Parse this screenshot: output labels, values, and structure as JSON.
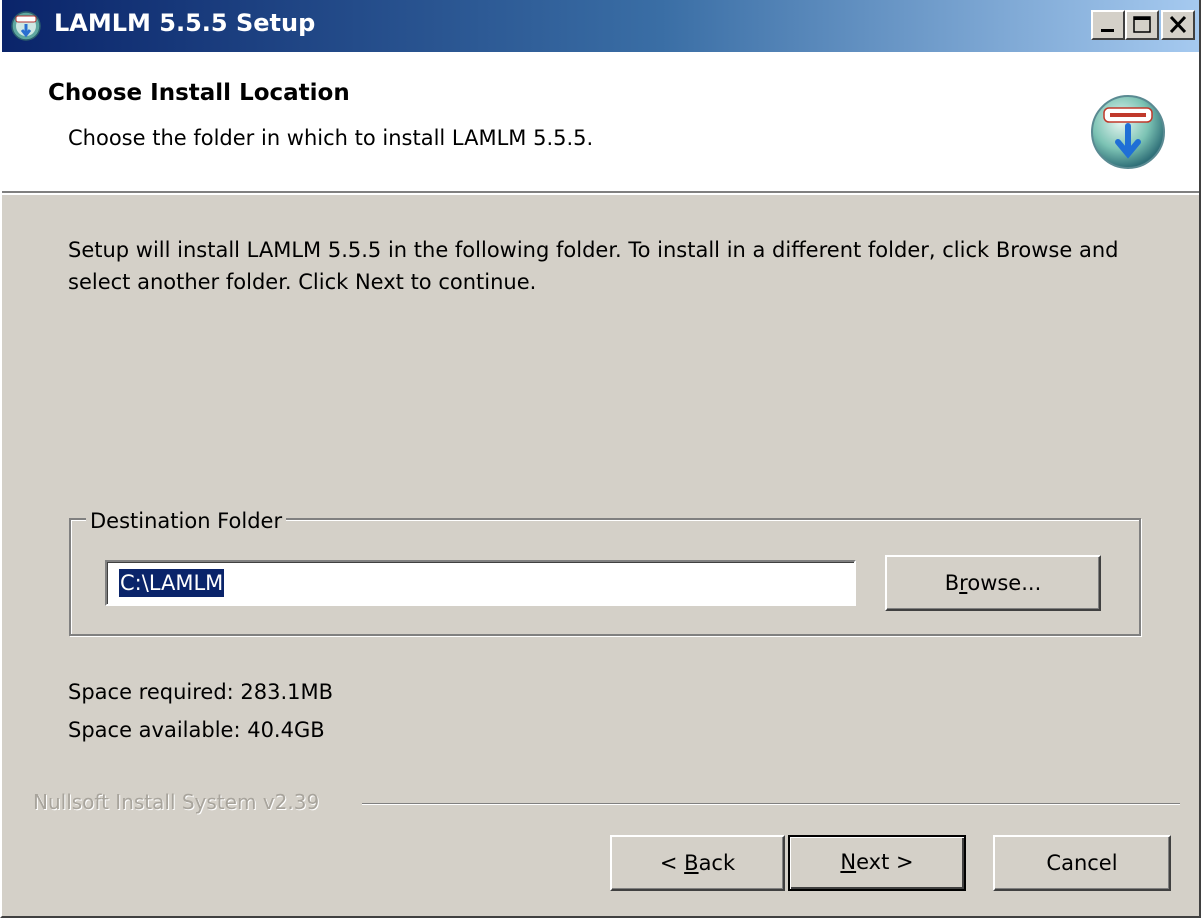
{
  "window": {
    "title": "LAMLM 5.5.5 Setup",
    "icon": "nsis-installer-icon",
    "controls": [
      "minimize-icon",
      "maximize-icon",
      "close-icon"
    ]
  },
  "header": {
    "title": "Choose Install Location",
    "subtitle": "Choose the folder in which to install LAMLM 5.5.5.",
    "icon": "nsis-installer-icon"
  },
  "body": {
    "intro": "Setup will install LAMLM 5.5.5 in the following folder. To install in a different folder, click Browse and select another folder. Click Next to continue.",
    "group_label": "Destination Folder",
    "destination_value": "C:\\LAMLM",
    "browse_label_pre": "B",
    "browse_label_key": "r",
    "browse_label_post": "owse...",
    "space_required": "Space required: 283.1MB",
    "space_available": "Space available: 40.4GB"
  },
  "footer": {
    "branding": "Nullsoft Install System v2.39",
    "back_pre": "< ",
    "back_key": "B",
    "back_post": "ack",
    "next_key": "N",
    "next_post": "ext >",
    "cancel_label": "Cancel"
  },
  "colors": {
    "titlebar_start": "#0a246a",
    "titlebar_end": "#a6caf0",
    "face": "#d4d0c8",
    "selection": "#0a246a"
  }
}
